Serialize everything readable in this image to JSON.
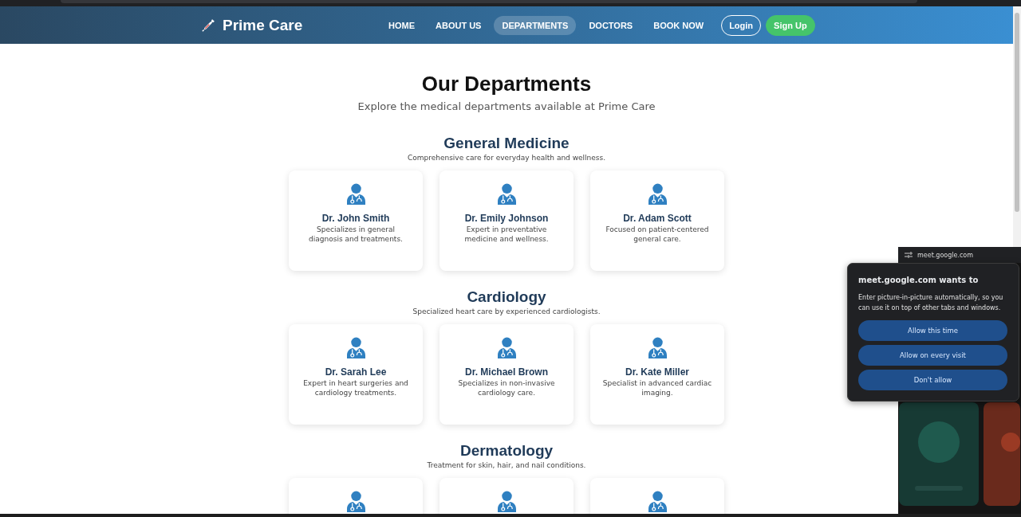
{
  "navbar": {
    "brand": "Prime Care",
    "links": [
      {
        "label": "HOME",
        "selected": false
      },
      {
        "label": "ABOUT US",
        "selected": false
      },
      {
        "label": "DEPARTMENTS",
        "selected": true
      },
      {
        "label": "DOCTORS",
        "selected": false
      },
      {
        "label": "BOOK NOW",
        "selected": false
      }
    ],
    "buttons": [
      {
        "label": "Login",
        "kind": "outline"
      },
      {
        "label": "Sign Up",
        "kind": "filled"
      }
    ]
  },
  "page": {
    "title": "Our Departments",
    "subtitle": "Explore the medical departments available at Prime Care"
  },
  "departments": [
    {
      "name": "General Medicine",
      "description": "Comprehensive care for everyday health and wellness.",
      "doctors": [
        {
          "name": "Dr. John Smith",
          "description": "Specializes in general diagnosis and treatments."
        },
        {
          "name": "Dr. Emily Johnson",
          "description": "Expert in preventative medicine and wellness."
        },
        {
          "name": "Dr. Adam Scott",
          "description": "Focused on patient-centered general care."
        }
      ]
    },
    {
      "name": "Cardiology",
      "description": "Specialized heart care by experienced cardiologists.",
      "doctors": [
        {
          "name": "Dr. Sarah Lee",
          "description": "Expert in heart surgeries and cardiology treatments."
        },
        {
          "name": "Dr. Michael Brown",
          "description": "Specializes in non-invasive cardiology care."
        },
        {
          "name": "Dr. Kate Miller",
          "description": "Specialist in advanced cardiac imaging."
        }
      ]
    },
    {
      "name": "Dermatology",
      "description": "Treatment for skin, hair, and nail conditions.",
      "doctors": [
        {
          "kind": "cut"
        },
        {
          "kind": "cut"
        },
        {
          "kind": "cut"
        }
      ]
    }
  ],
  "pip_window": {
    "site": "meet.google.com"
  },
  "permission_popup": {
    "title": "meet.google.com wants to",
    "message": "Enter picture-in-picture automatically, so you can use it on top of other tabs and windows.",
    "buttons": [
      "Allow this time",
      "Allow on every visit",
      "Don't allow"
    ]
  }
}
